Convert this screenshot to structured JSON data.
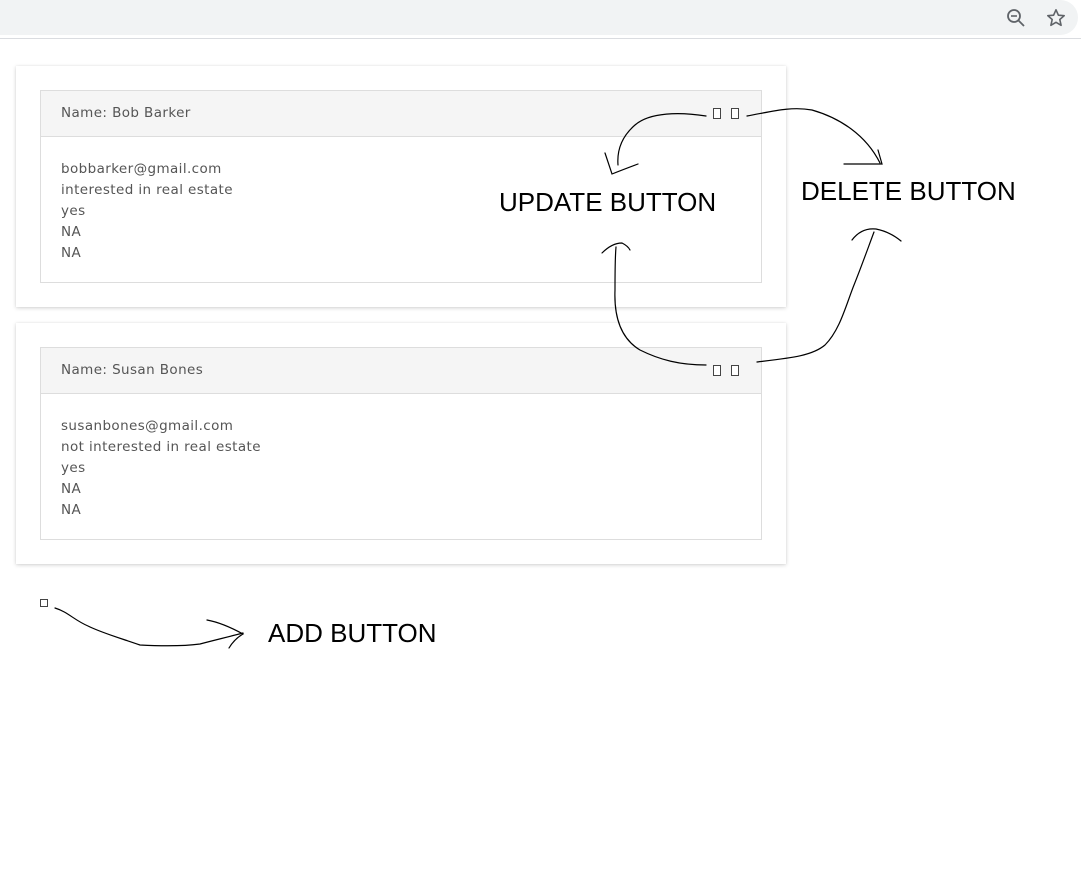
{
  "browser": {
    "icons": [
      "zoom-out-icon",
      "bookmark-star-icon"
    ]
  },
  "cards": [
    {
      "title": "Name: Bob Barker",
      "lines": [
        "bobbarker@gmail.com",
        "interested in real estate",
        "yes",
        "NA",
        "NA"
      ]
    },
    {
      "title": "Name: Susan Bones",
      "lines": [
        "susanbones@gmail.com",
        "not interested in real estate",
        "yes",
        "NA",
        "NA"
      ]
    }
  ],
  "annotations": {
    "update": "UPDATE BUTTON",
    "delete": "DELETE BUTTON",
    "add": "ADD BUTTON"
  }
}
